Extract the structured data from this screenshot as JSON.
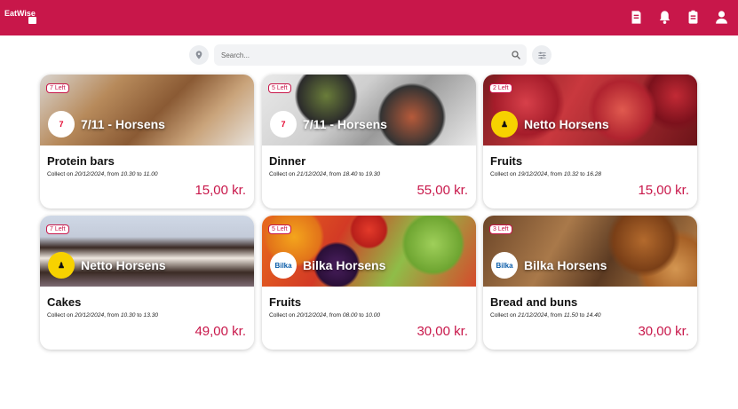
{
  "header": {
    "logo_text": "EatWise",
    "icons": [
      "receipt-icon",
      "bell-icon",
      "clipboard-icon",
      "user-icon"
    ]
  },
  "search": {
    "placeholder": "Search...",
    "value": ""
  },
  "colors": {
    "brand": "#c8174a",
    "background": "#ffffff"
  },
  "cards": [
    {
      "left": "7 Left",
      "store": "7/11 - Horsens",
      "title": "Protein bars",
      "collect_prefix": "Collect on ",
      "date": "20/12/2024",
      "from_label": ", from ",
      "from": "10.30",
      "to_label": " to ",
      "to": "11.00",
      "price": "15,00 kr."
    },
    {
      "left": "5 Left",
      "store": "7/11 - Horsens",
      "title": "Dinner",
      "collect_prefix": "Collect on ",
      "date": "21/12/2024",
      "from_label": ", from ",
      "from": "18.40",
      "to_label": " to ",
      "to": "19.30",
      "price": "55,00 kr."
    },
    {
      "left": "2 Left",
      "store": "Netto Horsens",
      "title": "Fruits",
      "collect_prefix": "Collect on ",
      "date": "19/12/2024",
      "from_label": ", from ",
      "from": "10.32",
      "to_label": " to ",
      "to": "16.28",
      "price": "15,00 kr."
    },
    {
      "left": "7 Left",
      "store": "Netto Horsens",
      "title": "Cakes",
      "collect_prefix": "Collect on ",
      "date": "20/12/2024",
      "from_label": ", from ",
      "from": "10.30",
      "to_label": " to ",
      "to": "13.30",
      "price": "49,00 kr."
    },
    {
      "left": "5 Left",
      "store": "Bilka Horsens",
      "title": "Fruits",
      "collect_prefix": "Collect on ",
      "date": "20/12/2024",
      "from_label": ", from ",
      "from": "08.00",
      "to_label": " to ",
      "to": "10.00",
      "price": "30,00 kr."
    },
    {
      "left": "3 Left",
      "store": "Bilka Horsens",
      "title": "Bread and buns",
      "collect_prefix": "Collect on ",
      "date": "21/12/2024",
      "from_label": ", from ",
      "from": "11.50",
      "to_label": " to ",
      "to": "14.40",
      "price": "30,00 kr."
    }
  ]
}
